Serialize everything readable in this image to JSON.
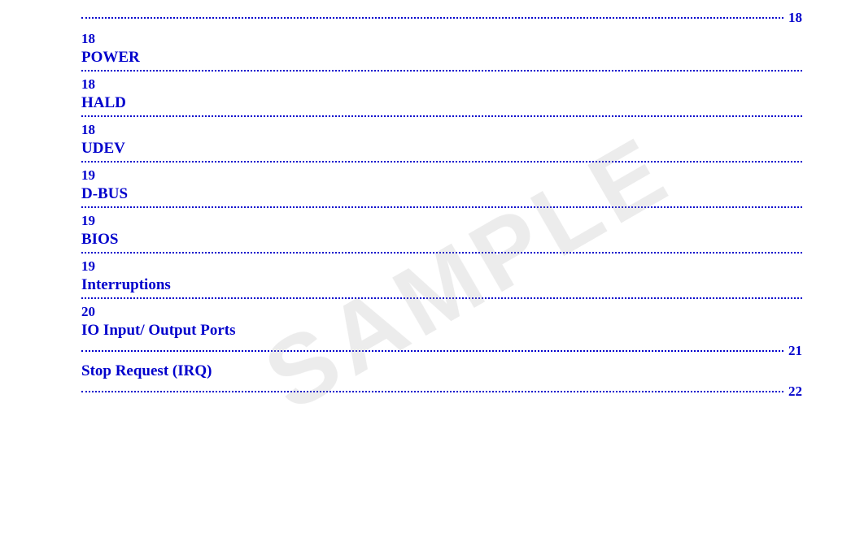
{
  "watermark": {
    "text": "SAMPLE"
  },
  "toc": {
    "entries": [
      {
        "id": "entry-top",
        "end_number": "18",
        "page_number": null,
        "title": null,
        "has_top_dots_with_number": true
      },
      {
        "id": "entry-power",
        "page_number": "18",
        "title": "POWER",
        "has_top_dots_with_number": false
      },
      {
        "id": "entry-hald",
        "page_number": "18",
        "title": "HALD",
        "has_top_dots_with_number": false
      },
      {
        "id": "entry-udev",
        "page_number": "18",
        "title": "UDEV",
        "has_top_dots_with_number": false
      },
      {
        "id": "entry-dbus",
        "page_number": "19",
        "title": "D-BUS",
        "has_top_dots_with_number": false
      },
      {
        "id": "entry-bios",
        "page_number": "19",
        "title": "BIOS",
        "has_top_dots_with_number": false
      },
      {
        "id": "entry-interruptions",
        "page_number": "19",
        "title": "Interruptions",
        "has_top_dots_with_number": false
      },
      {
        "id": "entry-io",
        "page_number": "20",
        "title": "IO Input/ Output Ports",
        "has_top_dots_with_number": false
      },
      {
        "id": "entry-stop-request",
        "end_number": "21",
        "page_number": null,
        "title": "Stop Request (IRQ)",
        "has_top_dots_with_number": true,
        "show_title": true
      },
      {
        "id": "entry-bottom",
        "end_number": "22",
        "page_number": null,
        "title": null,
        "has_top_dots_with_number": true
      }
    ]
  }
}
